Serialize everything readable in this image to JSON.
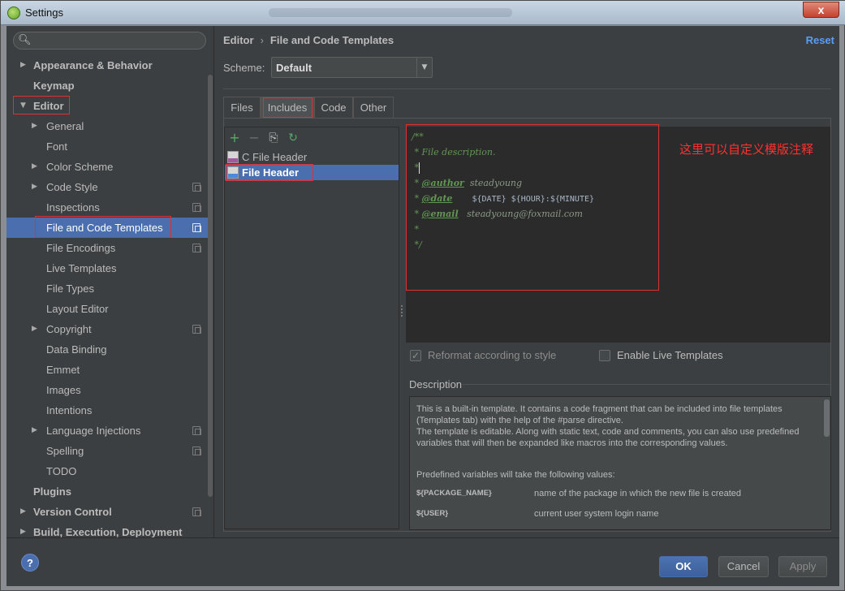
{
  "window": {
    "title": "Settings",
    "close_label": "x"
  },
  "sidebar": {
    "search_placeholder": "",
    "items": [
      {
        "label": "Appearance & Behavior",
        "level": 0,
        "bold": true,
        "arrow": "▶"
      },
      {
        "label": "Keymap",
        "level": 0,
        "bold": true
      },
      {
        "label": "Editor",
        "level": 0,
        "bold": true,
        "arrow": "▼",
        "highlighted": true
      },
      {
        "label": "General",
        "level": 1,
        "arrow": "▶"
      },
      {
        "label": "Font",
        "level": 1
      },
      {
        "label": "Color Scheme",
        "level": 1,
        "arrow": "▶"
      },
      {
        "label": "Code Style",
        "level": 1,
        "arrow": "▶",
        "copy": true
      },
      {
        "label": "Inspections",
        "level": 1,
        "copy": true
      },
      {
        "label": "File and Code Templates",
        "level": 1,
        "copy": true,
        "selected": true,
        "highlighted": true
      },
      {
        "label": "File Encodings",
        "level": 1,
        "copy": true
      },
      {
        "label": "Live Templates",
        "level": 1
      },
      {
        "label": "File Types",
        "level": 1
      },
      {
        "label": "Layout Editor",
        "level": 1
      },
      {
        "label": "Copyright",
        "level": 1,
        "arrow": "▶",
        "copy": true
      },
      {
        "label": "Data Binding",
        "level": 1
      },
      {
        "label": "Emmet",
        "level": 1
      },
      {
        "label": "Images",
        "level": 1
      },
      {
        "label": "Intentions",
        "level": 1
      },
      {
        "label": "Language Injections",
        "level": 1,
        "arrow": "▶",
        "copy": true
      },
      {
        "label": "Spelling",
        "level": 1,
        "copy": true
      },
      {
        "label": "TODO",
        "level": 1
      },
      {
        "label": "Plugins",
        "level": 0,
        "bold": true
      },
      {
        "label": "Version Control",
        "level": 0,
        "bold": true,
        "arrow": "▶",
        "copy": true
      },
      {
        "label": "Build, Execution, Deployment",
        "level": 0,
        "bold": true,
        "arrow": "▶"
      }
    ]
  },
  "main": {
    "breadcrumb": {
      "parent": "Editor",
      "separator": "›",
      "current": "File and Code Templates"
    },
    "reset_label": "Reset",
    "scheme": {
      "label": "Scheme:",
      "value": "Default"
    },
    "tabs": [
      {
        "label": "Files"
      },
      {
        "label": "Includes",
        "active": true
      },
      {
        "label": "Code"
      },
      {
        "label": "Other"
      }
    ],
    "toolbar": {
      "add": "+",
      "remove": "−",
      "copy": "⎘",
      "reset": "↻"
    },
    "list": [
      {
        "label": "C File Header"
      },
      {
        "label": "File Header",
        "selected": true
      }
    ],
    "editor": {
      "lines": {
        "l1": "/**",
        "l2": " * File description.",
        "l3": " *",
        "l4_prefix": " * ",
        "l4_tag": "@author",
        "l4_val": "  steadyoung",
        "l5_prefix": " * ",
        "l5_tag": "@date",
        "l5_val": "    ${DATE} ${HOUR}:${MINUTE}",
        "l6_prefix": " * ",
        "l6_tag": "@email",
        "l6_val": "   steadyoung@foxmail.com",
        "l7": " *",
        "l8": " */"
      },
      "annotation": "这里可以自定义模版注释"
    },
    "options": {
      "reformat": {
        "label": "Reformat according to style",
        "checked": true
      },
      "live_templates": {
        "label": "Enable Live Templates",
        "checked": false
      }
    },
    "description": {
      "label": "Description",
      "para1": "This is a built-in template. It contains a code fragment that can be included into file templates (Templates tab) with the help of the #parse directive.",
      "para2": "The template is editable. Along with static text, code and comments, you can also use predefined variables that will then be expanded like macros into the corresponding values.",
      "para3": "Predefined variables will take the following values:",
      "vars": [
        {
          "name": "${PACKAGE_NAME}",
          "desc": "name of the package in which the new file is created"
        },
        {
          "name": "${USER}",
          "desc": "current user system login name"
        }
      ]
    }
  },
  "footer": {
    "help": "?",
    "ok": "OK",
    "cancel": "Cancel",
    "apply": "Apply"
  },
  "colors": {
    "selection": "#4b6eaf",
    "link": "#589df6",
    "annotation": "#ff3030",
    "highlight_box": "#e03030"
  }
}
